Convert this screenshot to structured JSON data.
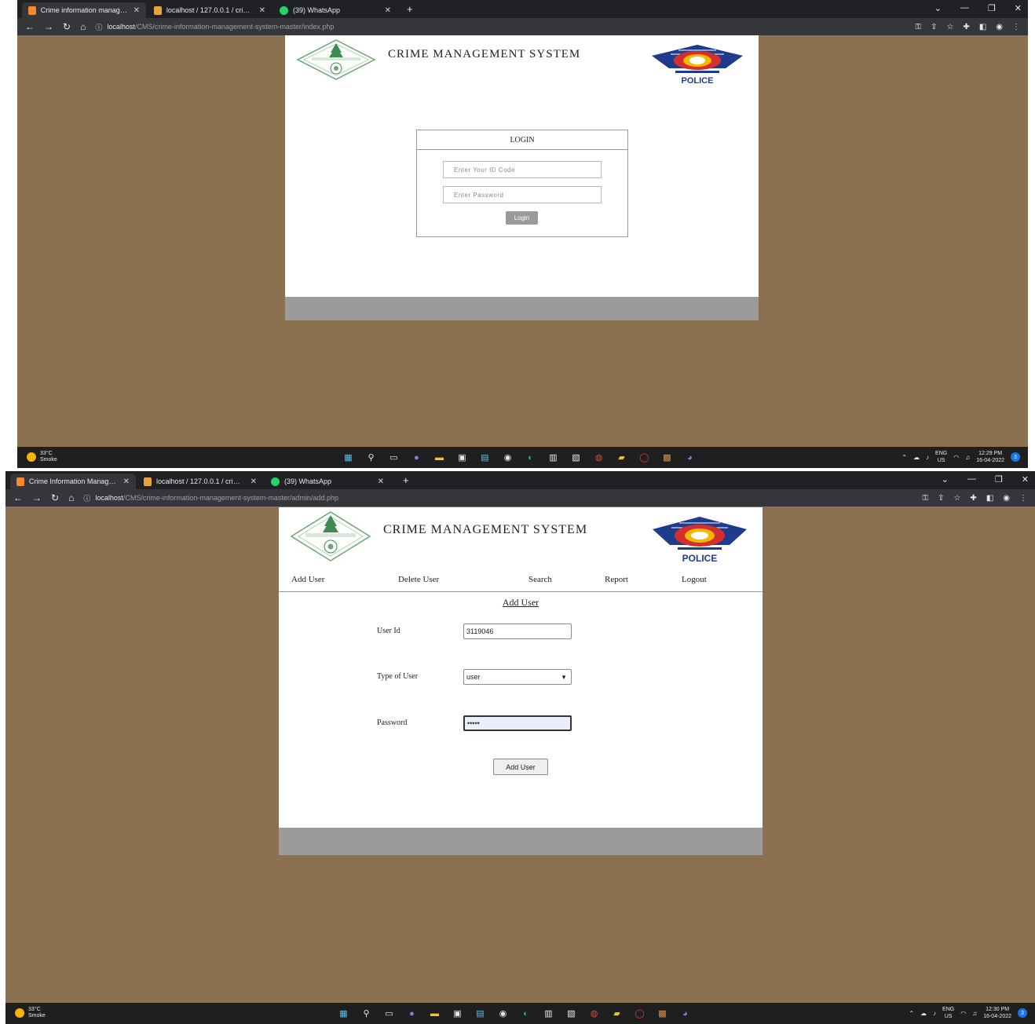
{
  "screens": [
    {
      "tabs": [
        {
          "title": "Crime information management",
          "icon_color": "#f28b30"
        },
        {
          "title": "localhost / 127.0.0.1 / crime / fir",
          "icon_color": "#e8a33d"
        },
        {
          "title": "(39) WhatsApp",
          "icon_color": "#25d366"
        }
      ],
      "url_host": "localhost",
      "url_path": "/CMS/crime-information-management-system-master/index.php",
      "time": "12:29 PM",
      "date": "16-04-2022"
    },
    {
      "tabs": [
        {
          "title": "Crime Information Management",
          "icon_color": "#f28b30"
        },
        {
          "title": "localhost / 127.0.0.1 / crime / fir",
          "icon_color": "#e8a33d"
        },
        {
          "title": "(39) WhatsApp",
          "icon_color": "#25d366"
        }
      ],
      "url_host": "localhost",
      "url_path": "/CMS/crime-information-management-system-master/admin/add.php",
      "time": "12:30 PM",
      "date": "16-04-2022"
    }
  ],
  "site": {
    "title": "CRIME MANAGEMENT SYSTEM",
    "police_label": "POLICE"
  },
  "login": {
    "heading": "LOGIN",
    "id_placeholder": "Enter Your ID Code",
    "password_placeholder": "Enter Password",
    "button": "Login"
  },
  "admin": {
    "menu": [
      "Add User",
      "Delete User",
      "Search",
      "Report",
      "Logout"
    ],
    "form_title": "Add User",
    "user_id_label": "User Id",
    "user_id_value": "3119046",
    "type_label": "Type of User",
    "type_value": "user",
    "password_label": "Password",
    "password_value": "•••••",
    "submit": "Add User"
  },
  "taskbar": {
    "temperature": "33°C",
    "weather": "Smoke",
    "lang_top": "ENG",
    "lang_bottom": "US",
    "notifications": "3"
  },
  "colors": {
    "desktop": "#8b7150",
    "footer": "#9b9b9b",
    "police_red": "#d32f2f",
    "police_blue": "#1f3b8c"
  }
}
